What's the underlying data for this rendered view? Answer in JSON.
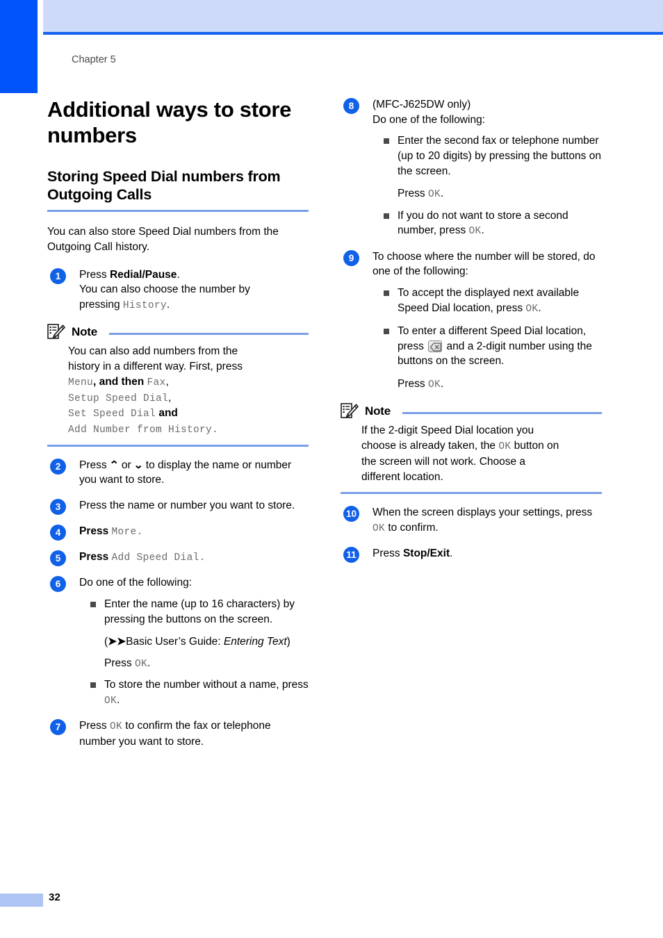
{
  "page": {
    "chapter_label": "Chapter 5",
    "page_number": "32",
    "accent_blue": "#0054fa",
    "header_band_blue": "#cddaf8",
    "rule_blue": "#7b9ee8",
    "step_circle_blue": "#1060e8"
  },
  "headings": {
    "h1": "Additional ways to store numbers",
    "h2": "Storing Speed Dial numbers from Outgoing Calls"
  },
  "intro": "You can also store Speed Dial numbers from the Outgoing Call history.",
  "note_label": "Note",
  "left_column": {
    "step1": {
      "num": "1",
      "line1_press": "Press ",
      "line1_bold": "Redial/Pause",
      "line1_end": ".",
      "line2": "You can also choose the number by",
      "line3_pre": "pressing ",
      "line3_lcd": "History",
      "line3_end": "."
    },
    "note1": {
      "line1": "You can also add numbers from the",
      "line2": "history in a different way. First, press",
      "line3_lcd": "Menu",
      "line3_mid": ", and then ",
      "line3_lcd2": "Fax",
      "line3_end": ",",
      "line4_lcd": "Setup Speed Dial",
      "line4_end": ",",
      "line5_lcd": "Set Speed Dial",
      "line5_end": " and",
      "line6_lcd": "Add Number from History",
      "line6_end": "."
    },
    "step2": {
      "num": "2",
      "pre": "Press ",
      "up": "⌃",
      "mid": " or ",
      "down": "⌄",
      "post": " to display the name or number you want to store."
    },
    "step3": {
      "num": "3",
      "text": "Press the name or number you want to store."
    },
    "step4": {
      "num": "4",
      "pre": "Press ",
      "lcd": "More",
      "post": "."
    },
    "step5": {
      "num": "5",
      "pre": "Press ",
      "lcd": "Add Speed Dial",
      "post": "."
    },
    "step6": {
      "num": "6",
      "text": "Do one of the following:",
      "bullet1": "Enter the name (up to 16 characters) by pressing the buttons on the screen.",
      "sub1_pre": "(",
      "sub1_arrows": "➤➤",
      "sub1_mid": "Basic User’s Guide: ",
      "sub1_italic": "Entering Text",
      "sub1_end": ")",
      "sub2_pre": "Press ",
      "sub2_lcd": "OK",
      "sub2_end": ".",
      "bullet2_pre": "To store the number without a name, press ",
      "bullet2_lcd": "OK",
      "bullet2_end": "."
    },
    "step7": {
      "num": "7",
      "pre": "Press ",
      "lcd": "OK",
      "post": " to confirm the fax or telephone number you want to store."
    }
  },
  "right_column": {
    "step8": {
      "num": "8",
      "line1": "(MFC-J625DW only)",
      "line2": "Do one of the following:",
      "bullet1": "Enter the second fax or telephone number (up to 20 digits) by pressing the buttons on the screen.",
      "sub1_pre": "Press ",
      "sub1_lcd": "OK",
      "sub1_end": ".",
      "bullet2_pre": "If you do not want to store a second number, press ",
      "bullet2_lcd": "OK",
      "bullet2_end": "."
    },
    "step9": {
      "num": "9",
      "text": "To choose where the number will be stored, do one of the following:",
      "bullet1_pre": "To accept the displayed next available Speed Dial location, press ",
      "bullet1_lcd": "OK",
      "bullet1_end": ".",
      "bullet2_pre": "To enter a different Speed Dial location, press ",
      "bullet2_icon": "backspace-key-icon",
      "bullet2_post": " and a 2-digit number using the buttons on the screen.",
      "sub_pre": "Press ",
      "sub_lcd": "OK",
      "sub_end": "."
    },
    "note2": {
      "line1": "If the 2-digit Speed Dial location you",
      "line2_pre": "choose is already taken, the ",
      "line2_lcd": "OK",
      "line2_post": " button on",
      "line3": "the screen will not work. Choose a",
      "line4": "different location."
    },
    "step10": {
      "num": "10",
      "pre": "When the screen displays your settings, press ",
      "lcd": "OK",
      "post": " to confirm."
    },
    "step11": {
      "num": "11",
      "pre": "Press ",
      "bold": "Stop/Exit",
      "post": "."
    }
  }
}
